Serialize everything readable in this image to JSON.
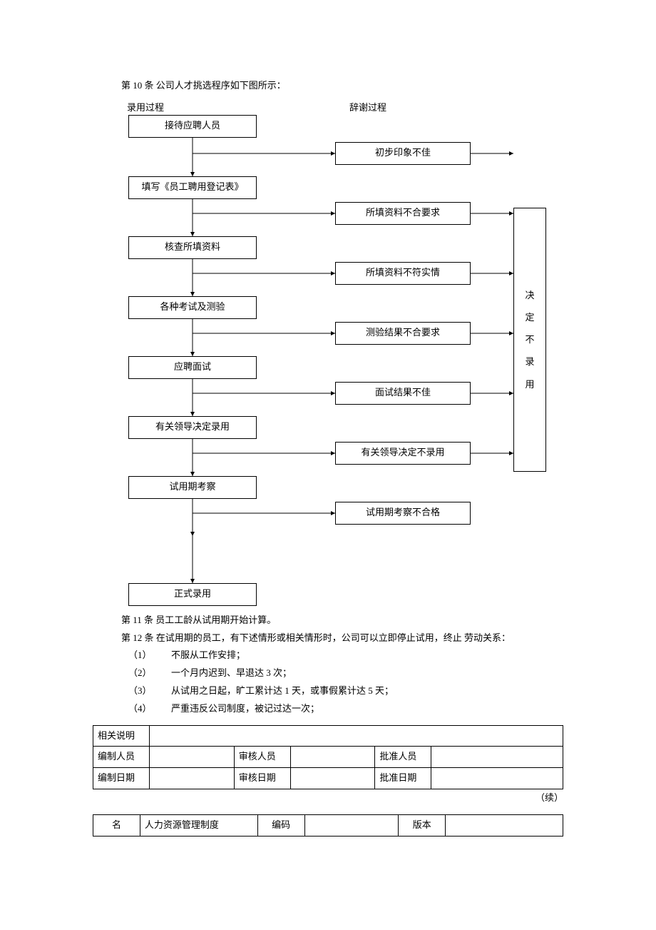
{
  "article10": "第 10 条  公司人才挑选程序如下图所示：",
  "article11": "第 11 条  员工工龄从试用期开始计算。",
  "article12": "第 12 条  在试用期的员工，有下述情形或相关情形时，公司可以立即停止试用，终止 劳动关系：",
  "list": {
    "i1": {
      "num": "（1）",
      "txt": "不服从工作安排；"
    },
    "i2": {
      "num": "（2）",
      "txt": "一个月内迟到、早退达  3 次；"
    },
    "i3": {
      "num": "（3）",
      "txt": "从试用之日起，旷工累计达  1 天，或事假累计达  5 天；"
    },
    "i4": {
      "num": "（4）",
      "txt": "严重违反公司制度，被记过达一次；"
    }
  },
  "flow": {
    "label_left": "录用过程",
    "label_right": "辞谢过程",
    "left": {
      "b1": "接待应聘人员",
      "b2": "填写《员工聘用登记表》",
      "b3": "核查所填资料",
      "b4": "各种考试及测验",
      "b5": "应聘面试",
      "b6": "有关领导决定录用",
      "b7": "试用期考察",
      "b8": "正式录用"
    },
    "right": {
      "r1": "初步印象不佳",
      "r2": "所填资料不合要求",
      "r3": "所填资料不符实情",
      "r4": "测验结果不合要求",
      "r5": "面试结果不佳",
      "r6": "有关领导决定不录用",
      "r7": "试用期考察不合格"
    },
    "big": "决\n定\n不\n录\n用"
  },
  "table1": {
    "r1c1": "相关说明",
    "r2c1": "编制人员",
    "r2c3": "审核人员",
    "r2c5": "批准人员",
    "r3c1": "编制日期",
    "r3c3": "审核日期",
    "r3c5": "批准日期"
  },
  "continue": "（续）",
  "table2": {
    "c1": "名",
    "c2": "人力资源管理制度",
    "c3": "编码",
    "c5": "版本"
  }
}
